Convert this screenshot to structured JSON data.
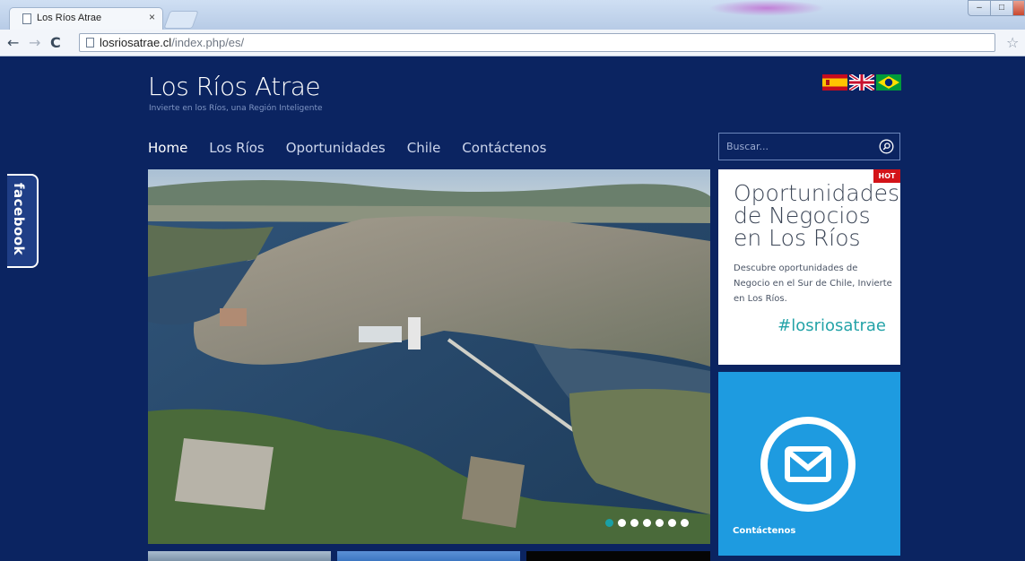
{
  "browser": {
    "tab_title": "Los Ríos Atrae",
    "tab_close": "×",
    "url_domain": "losriosatrae.cl",
    "url_path": "/index.php/es/",
    "nav_back": "←",
    "nav_forward": "→",
    "nav_reload": "C",
    "star": "☆",
    "win_min": "–",
    "win_max": "□",
    "win_close": ""
  },
  "site": {
    "title": "Los Ríos Atrae",
    "tagline": "Invierte en los Ríos, una Región Inteligente"
  },
  "languages": [
    "es",
    "en",
    "pt-br"
  ],
  "nav": {
    "items": [
      {
        "label": "Home",
        "active": true
      },
      {
        "label": "Los Ríos"
      },
      {
        "label": "Oportunidades"
      },
      {
        "label": "Chile"
      },
      {
        "label": "Contáctenos"
      }
    ]
  },
  "search": {
    "placeholder": "Buscar..."
  },
  "slider": {
    "slide_count": 7,
    "active_index": 0
  },
  "promo": {
    "badge": "HOT",
    "title": "Oportunidades de Negocios en Los Ríos",
    "text": "Descubre oportunidades de Negocio en el Sur de Chile, Invierte en Los Ríos.",
    "hashtag": "#losriosatrae"
  },
  "contact": {
    "label": "Contáctenos",
    "icon": "mail-icon"
  },
  "facebook": {
    "label": "facebook"
  },
  "colors": {
    "page_bg": "#0b2461",
    "contact_bg": "#1e9be0",
    "hashtag": "#24a3a8",
    "hot_badge": "#d31318"
  }
}
